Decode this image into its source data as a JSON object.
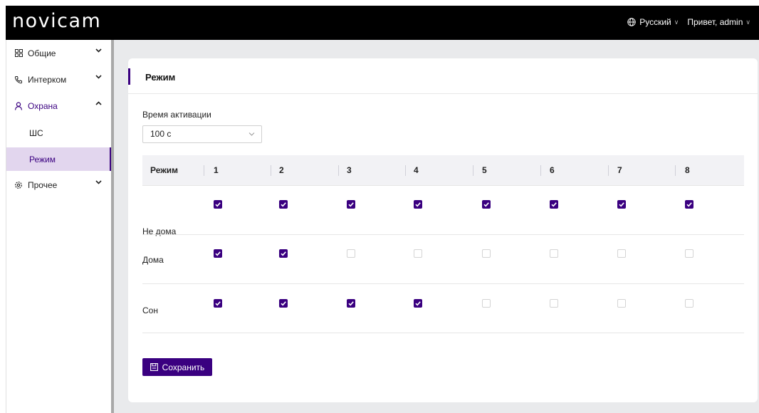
{
  "app": {
    "logo": "novicam"
  },
  "header": {
    "language": "Русский",
    "user_greeting": "Привет, admin"
  },
  "sidebar": {
    "items": [
      {
        "label": "Общие",
        "icon": "grid-icon",
        "expanded": false
      },
      {
        "label": "Интерком",
        "icon": "phone-icon",
        "expanded": false
      },
      {
        "label": "Охрана",
        "icon": "user-icon",
        "expanded": true
      },
      {
        "label": "Прочее",
        "icon": "gear-icon",
        "expanded": false
      }
    ],
    "subitems": [
      {
        "label": "ШС",
        "active": false
      },
      {
        "label": "Режим",
        "active": true
      }
    ]
  },
  "card": {
    "title": "Режим"
  },
  "activation": {
    "label": "Время активации",
    "value": "100 с"
  },
  "table": {
    "columns": [
      "Режим",
      "1",
      "2",
      "3",
      "4",
      "5",
      "6",
      "7",
      "8"
    ],
    "rows": [
      {
        "label": "Не дома",
        "checks": [
          true,
          true,
          true,
          true,
          true,
          true,
          true,
          true
        ]
      },
      {
        "label": "Дома",
        "checks": [
          true,
          true,
          false,
          false,
          false,
          false,
          false,
          false
        ]
      },
      {
        "label": "Сон",
        "checks": [
          true,
          true,
          true,
          true,
          false,
          false,
          false,
          false
        ]
      }
    ]
  },
  "actions": {
    "save_label": "Сохранить"
  },
  "colors": {
    "accent": "#3a0080",
    "topbar": "#000000",
    "active_bg": "#e2d6ee",
    "content_bg": "#e9eaec"
  }
}
